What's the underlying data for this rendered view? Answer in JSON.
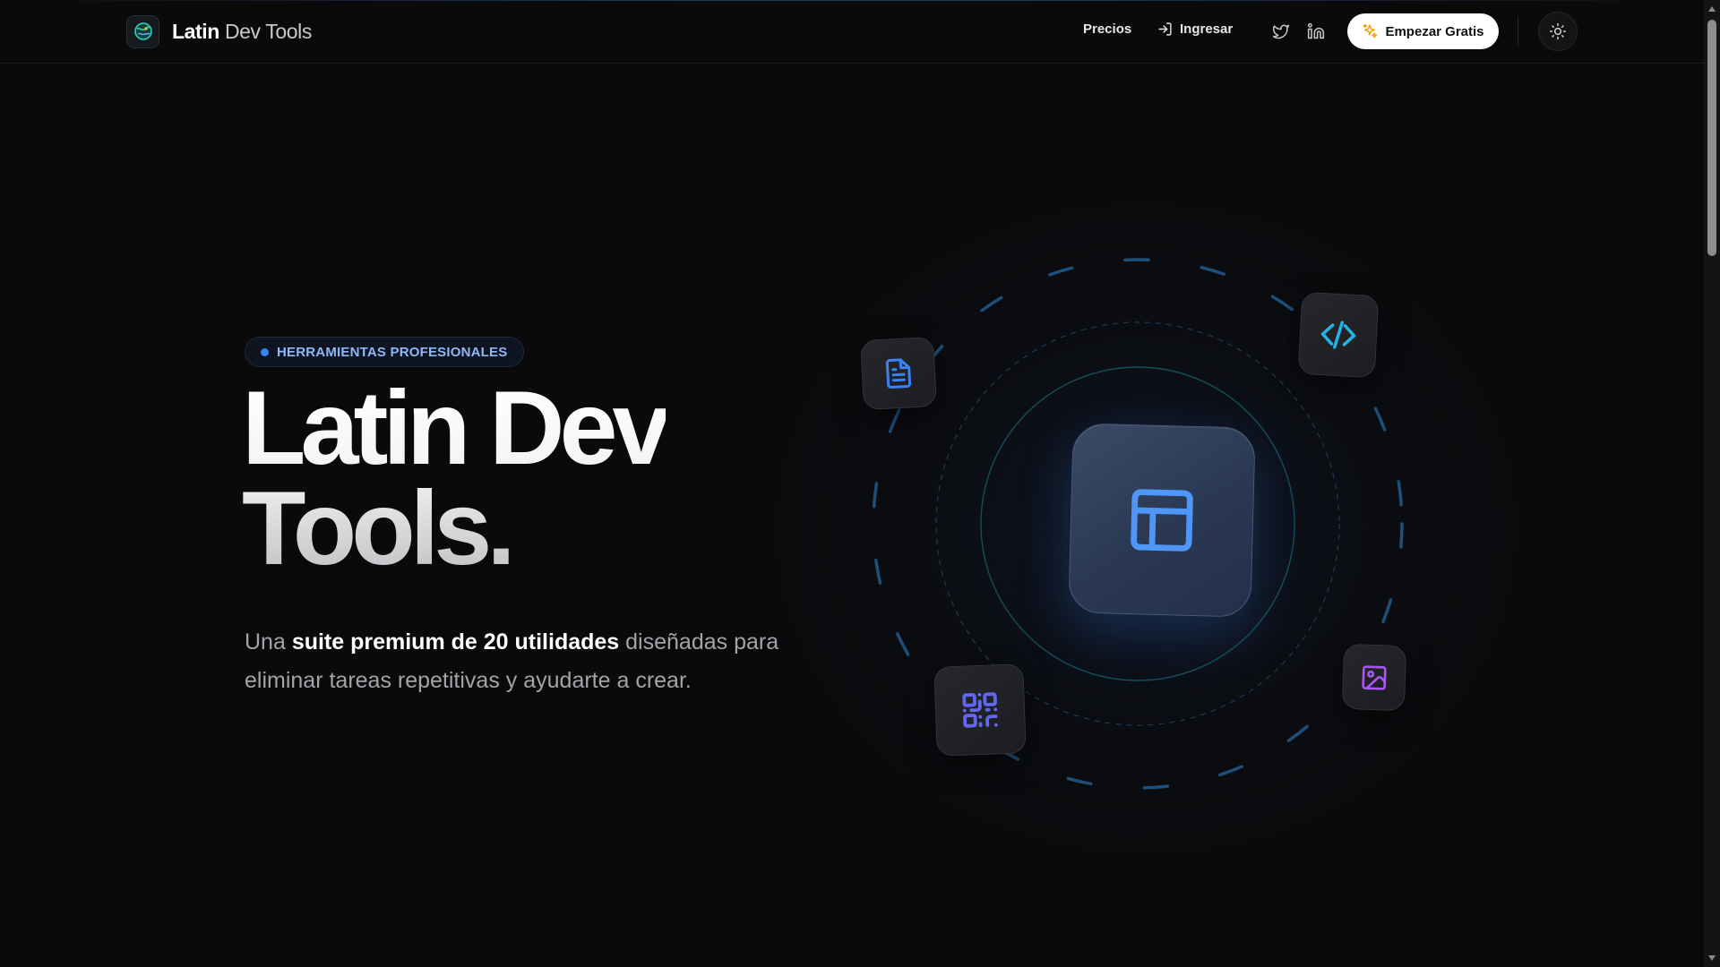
{
  "header": {
    "brand": {
      "name_strong": "Latin",
      "name_light": "Dev Tools",
      "logo_icon": "globe-logo-icon"
    },
    "nav": [
      {
        "label": "Precios"
      },
      {
        "label": "Ingresar",
        "icon": "login-icon"
      }
    ],
    "social": [
      {
        "icon": "twitter-icon"
      },
      {
        "icon": "linkedin-icon"
      }
    ],
    "cta": {
      "label": "Empezar Gratis",
      "icon": "sparkles-icon"
    },
    "theme_toggle": {
      "icon": "sun-icon"
    }
  },
  "hero": {
    "badge": "HERRAMIENTAS PROFESIONALES",
    "title_line1": "Latin Dev",
    "title_line2": "Tools.",
    "description": {
      "part1": "Una ",
      "bold": "suite premium de 20 utilidades",
      "part2": " diseñadas para eliminar tareas repetitivas y ayudarte a crear."
    }
  },
  "illustration": {
    "center_icon": "layout-icon",
    "tiles": [
      {
        "icon": "document-icon",
        "color": "#3b82f6"
      },
      {
        "icon": "code-icon",
        "color": "#22b4e6"
      },
      {
        "icon": "qr-code-icon",
        "color": "#6366f1"
      },
      {
        "icon": "image-icon",
        "color": "#a855f7"
      }
    ]
  },
  "colors": {
    "background": "#0a0a0b",
    "accent": "#3b82f6",
    "cta_background": "#ffffff",
    "cta_icon": "#f59e0b"
  }
}
